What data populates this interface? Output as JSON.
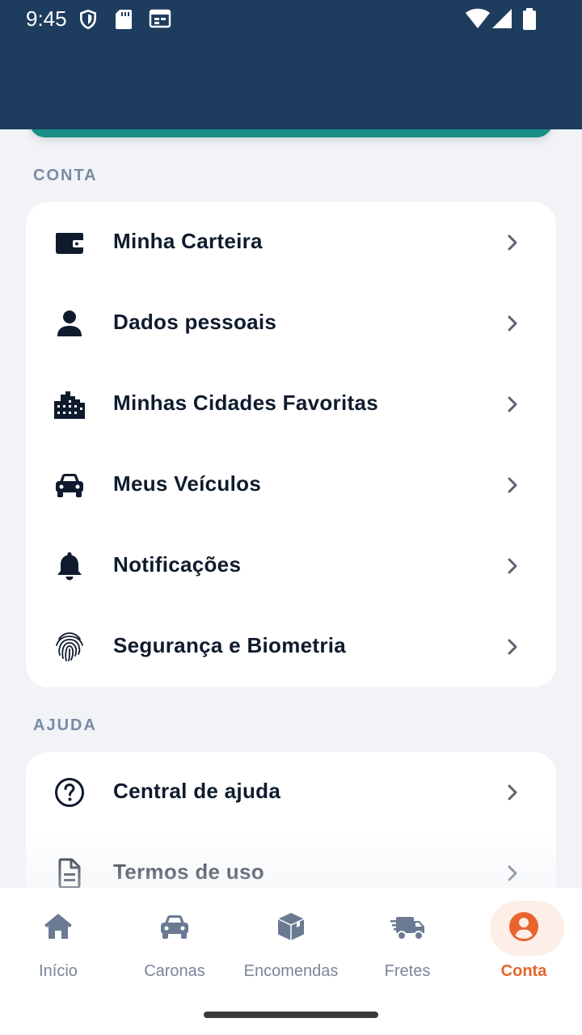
{
  "status_bar": {
    "time": "9:45"
  },
  "sections": {
    "account": {
      "heading": "CONTA",
      "items": [
        {
          "label": "Minha Carteira",
          "icon": "wallet-icon"
        },
        {
          "label": "Dados pessoais",
          "icon": "person-icon"
        },
        {
          "label": "Minhas Cidades Favoritas",
          "icon": "city-icon"
        },
        {
          "label": "Meus Veículos",
          "icon": "car-icon"
        },
        {
          "label": "Notificações",
          "icon": "bell-icon"
        },
        {
          "label": "Segurança e Biometria",
          "icon": "fingerprint-icon"
        }
      ]
    },
    "help": {
      "heading": "AJUDA",
      "items": [
        {
          "label": "Central de ajuda",
          "icon": "help-circle-icon"
        },
        {
          "label": "Termos de uso",
          "icon": "document-icon"
        }
      ]
    }
  },
  "bottom_nav": {
    "items": [
      {
        "label": "Início",
        "icon": "home-icon"
      },
      {
        "label": "Caronas",
        "icon": "car-icon"
      },
      {
        "label": "Encomendas",
        "icon": "package-icon"
      },
      {
        "label": "Fretes",
        "icon": "truck-icon"
      },
      {
        "label": "Conta",
        "icon": "account-circle-icon",
        "active": true
      }
    ]
  },
  "colors": {
    "header": "#1e3d5e",
    "accent_teal": "#1a8f86",
    "active_nav": "#e8642c",
    "background": "#f1f3f7"
  }
}
